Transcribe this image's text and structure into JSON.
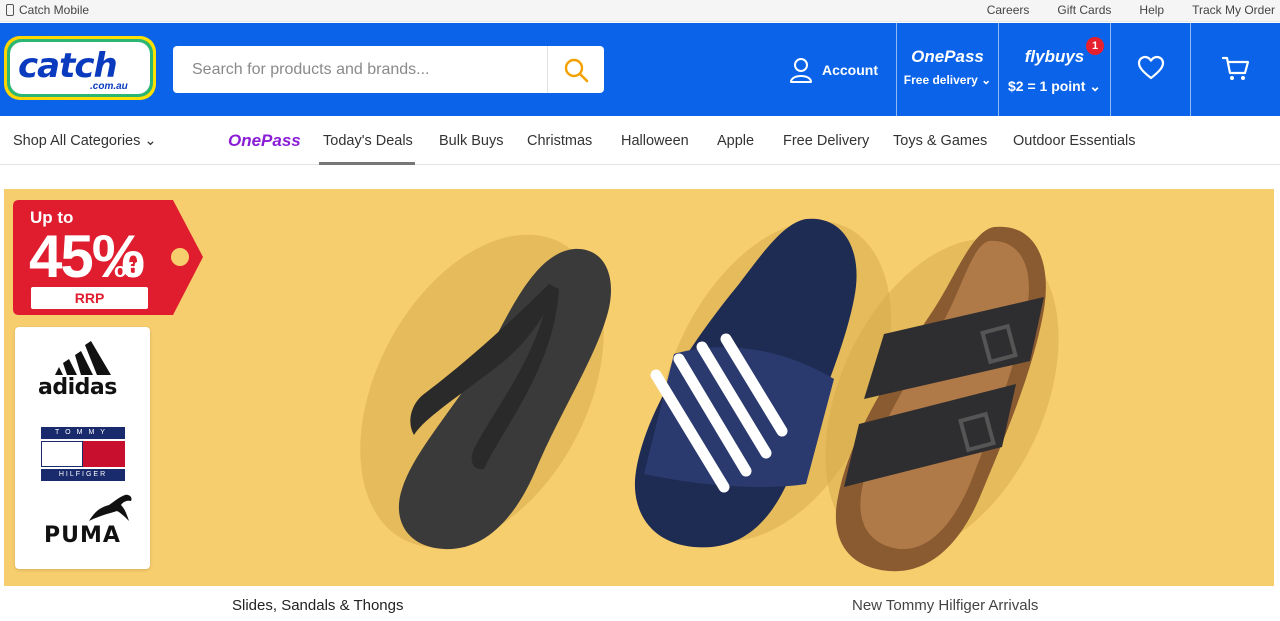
{
  "utility": {
    "mobile_label": "Catch Mobile",
    "links": [
      "Careers",
      "Gift Cards",
      "Help",
      "Track My Order"
    ]
  },
  "header": {
    "logo_text": "catch",
    "logo_sub": ".com.au",
    "search_placeholder": "Search for products and brands...",
    "account_label": "Account",
    "onepass_title": "OnePass",
    "onepass_sub": "Free delivery ⌄",
    "flybuys_title": "flybuys",
    "flybuys_sub": "$2 = 1 point ⌄",
    "flybuys_badge": "1"
  },
  "nav": {
    "shop_all": "Shop All Categories  ⌄",
    "onepass": "OnePass",
    "items": [
      "Today's Deals",
      "Bulk Buys",
      "Christmas",
      "Halloween",
      "Apple",
      "Free Delivery",
      "Toys & Games",
      "Outdoor Essentials"
    ],
    "active_item": "Today's Deals"
  },
  "banner": {
    "tag_line1": "Up to",
    "tag_percent": "45%",
    "tag_off": "off",
    "tag_rrp": "RRP",
    "brands": [
      "adidas",
      "TOMMY HILFIGER",
      "PUMA"
    ],
    "tommy_top": "TOMMY",
    "tommy_bottom": "HILFIGER"
  },
  "captions": {
    "left": "Slides, Sandals & Thongs",
    "right": "New Tommy Hilfiger Arrivals"
  },
  "colors": {
    "brand_blue": "#0a63e8",
    "banner_yellow": "#f7ce6e",
    "tag_red": "#e01d2f",
    "onepass_purple": "#8a1cd6"
  }
}
